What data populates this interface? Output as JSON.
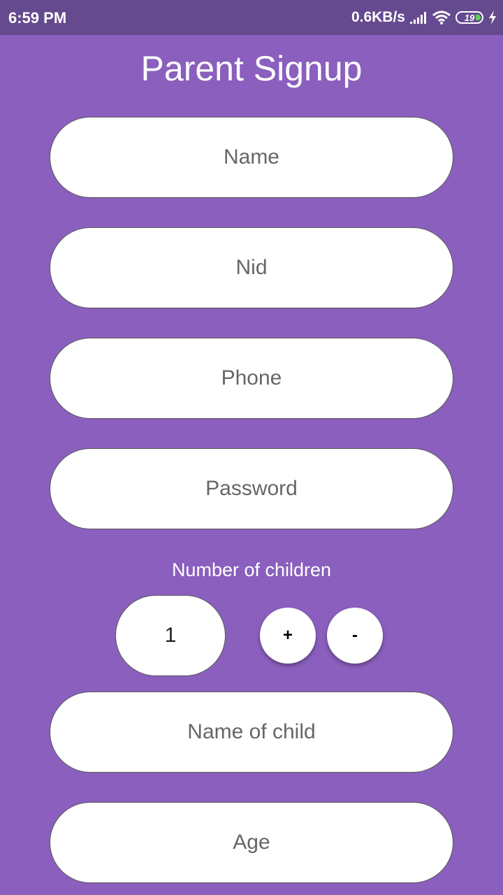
{
  "status_bar": {
    "time": "6:59 PM",
    "net_speed": "0.6KB/s",
    "battery_level": "19",
    "signal_icon": "signal-icon",
    "wifi_icon": "wifi-icon",
    "charging_icon": "charging-bolt-icon"
  },
  "header": {
    "title": "Parent Signup"
  },
  "form": {
    "name_placeholder": "Name",
    "nid_placeholder": "Nid",
    "phone_placeholder": "Phone",
    "password_placeholder": "Password",
    "children_label": "Number of children",
    "children_count": "1",
    "increment_label": "+",
    "decrement_label": "-",
    "child_name_placeholder": "Name of child",
    "age_placeholder": "Age"
  },
  "colors": {
    "background": "#8a5fbd",
    "status_bar": "#654a8f",
    "field_background": "#ffffff",
    "battery_fill": "#5ad35a"
  }
}
